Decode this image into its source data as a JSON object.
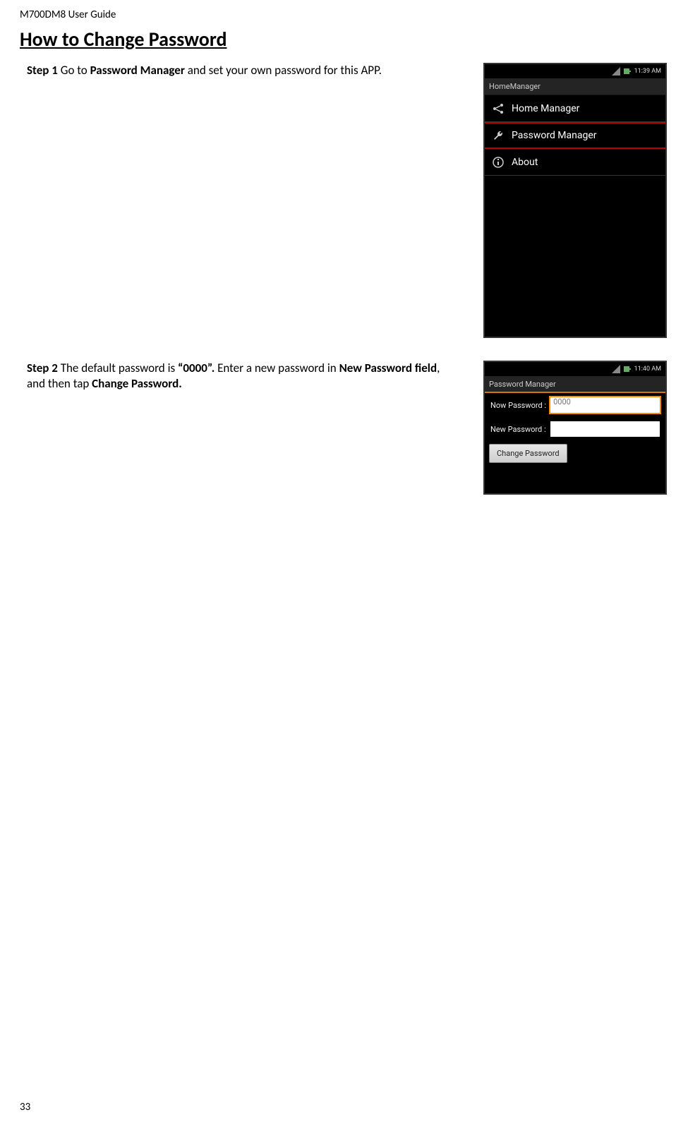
{
  "header": "M700DM8 User Guide",
  "heading": "How to Change Password",
  "steps": {
    "step1_label": "Step 1",
    "step1_pre": " Go to ",
    "step1_bold": "Password Manager",
    "step1_post": " and set your own password for this APP.",
    "step2_label": "Step 2",
    "step2_text1": " The default password is ",
    "step2_bold1": "“0000”.",
    "step2_text2": " Enter a new password in ",
    "step2_bold2": "New Password field",
    "step2_text3": ", and then tap ",
    "step2_bold3": "Change Password."
  },
  "screen1": {
    "time": "11:39 AM",
    "title": "HomeManager",
    "items": [
      {
        "label": "Home Manager",
        "selected": false
      },
      {
        "label": "Password Manager",
        "selected": true
      },
      {
        "label": "About",
        "selected": false
      }
    ]
  },
  "screen2": {
    "time": "11:40 AM",
    "title": "Password Manager",
    "now_label": "Now Password :",
    "now_value": "0000",
    "new_label": "New Password :",
    "new_value": "",
    "button": "Change Password"
  },
  "page_number": "33"
}
